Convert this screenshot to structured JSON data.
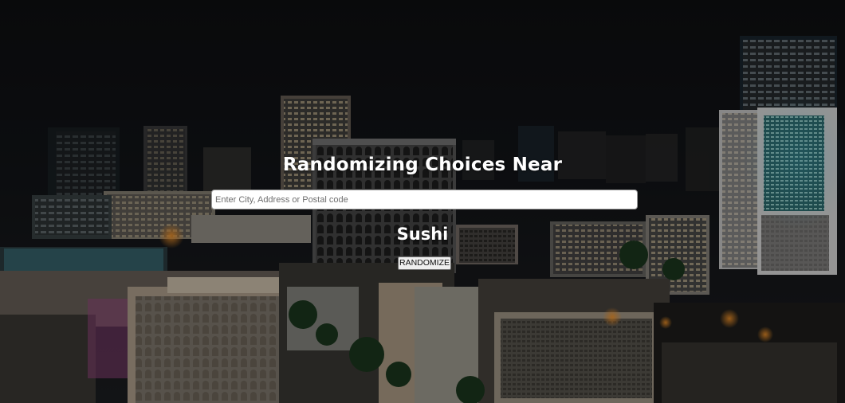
{
  "hero": {
    "heading": "Randomizing Choices Near",
    "search_placeholder": "Enter City, Address or Postal code",
    "search_value": "",
    "current_choice": "Sushi",
    "randomize_label": "RANDOMIZE"
  },
  "background": {
    "description_icon": "night-city-photo"
  },
  "colors": {
    "sky": "#111214",
    "heading_text": "#ffffff",
    "button_bg": "#efefef",
    "input_bg": "#ffffff"
  }
}
